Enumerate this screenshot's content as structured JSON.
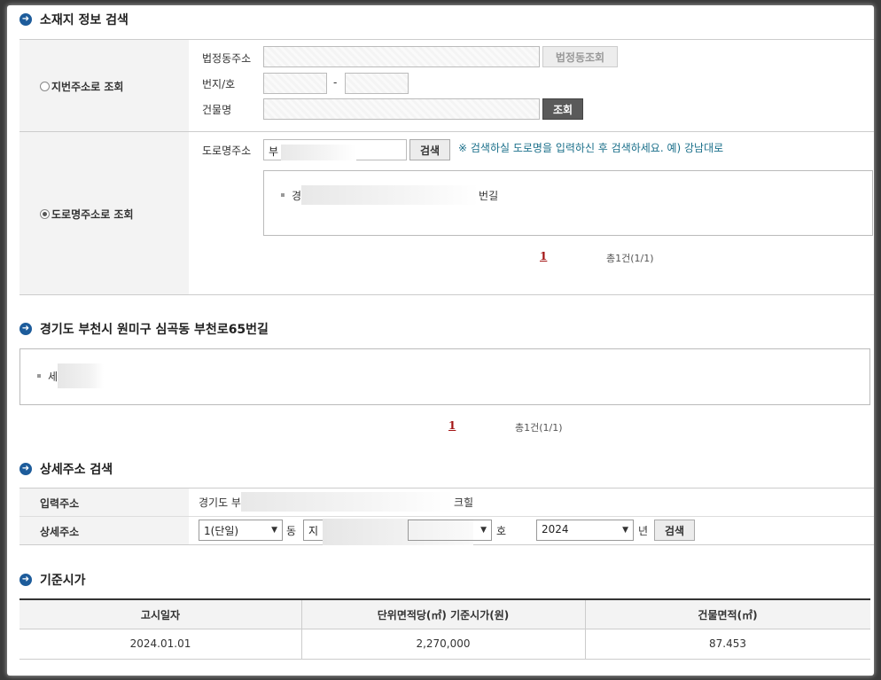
{
  "sections": {
    "location_search": "소재지 정보 검색",
    "selected_road": "경기도 부천시 원미구 심곡동 부천로65번길",
    "detail_search": "상세주소 검색",
    "standard_price": "기준시가"
  },
  "lot_search": {
    "radio_label": "지번주소로 조회",
    "legal_dong_label": "법정동주소",
    "legal_dong_button": "법정동조회",
    "lot_number_label": "번지/호",
    "lot_dash": "-",
    "building_label": "건물명",
    "search_button": "조회"
  },
  "road_search": {
    "radio_label": "도로명주소로 조회",
    "road_label": "도로명주소",
    "road_value": "부",
    "search_button": "검색",
    "hint": "※ 검색하실 도로명을 입력하신 후 검색하세요. 예) 강남대로",
    "result_prefix": "경",
    "result_suffix": "번길",
    "page": "1",
    "total": "총1건(1/1)"
  },
  "building_list": {
    "item_prefix": "세",
    "page": "1",
    "total": "총1건(1/1)"
  },
  "detail": {
    "input_label": "입력주소",
    "input_prefix": "경기도 부",
    "input_suffix": "크힐",
    "detail_label": "상세주소",
    "dong_select": "1(단일)",
    "dong_unit": "동",
    "floor_prefix": "지",
    "ho_unit": "호",
    "year_select": "2024",
    "year_unit": "년",
    "search_button": "검색"
  },
  "price_table": {
    "headers": [
      "고시일자",
      "단위면적당(㎡) 기준시가(원)",
      "건물면적(㎡)"
    ],
    "rows": [
      [
        "2024.01.01",
        "2,270,000",
        "87.453"
      ]
    ]
  }
}
